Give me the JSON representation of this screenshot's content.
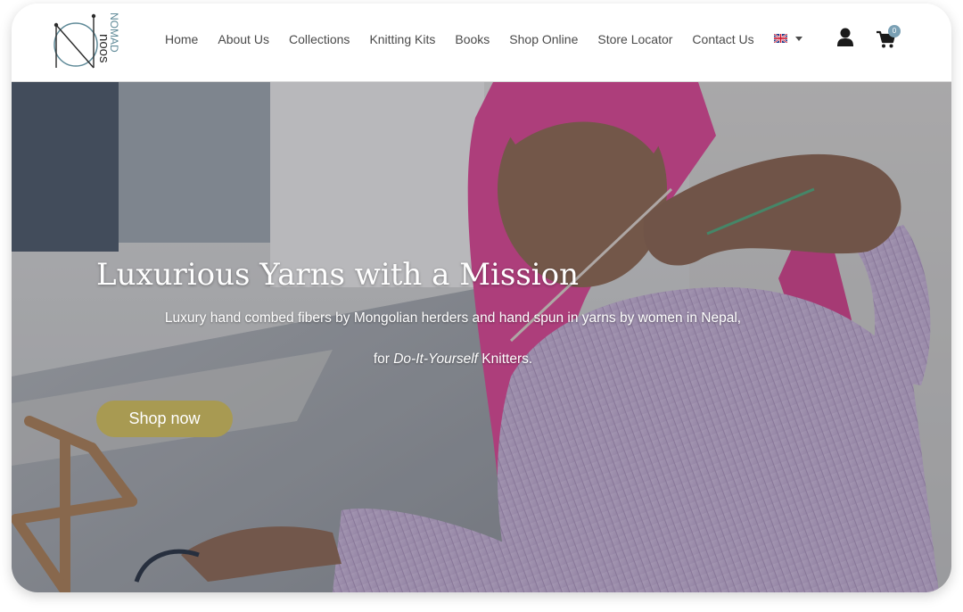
{
  "brand": {
    "logo_text_top": "NOMAD",
    "logo_text_bottom": "noos",
    "colors": {
      "accent": "#a89a52",
      "logo_teal": "#5f8a98",
      "text": "#4a4a4a",
      "badge": "#7aa0b4"
    }
  },
  "nav": {
    "items": [
      {
        "label": "Home"
      },
      {
        "label": "About Us"
      },
      {
        "label": "Collections"
      },
      {
        "label": "Knitting Kits"
      },
      {
        "label": "Books"
      },
      {
        "label": "Shop Online"
      },
      {
        "label": "Store Locator"
      },
      {
        "label": "Contact Us"
      }
    ],
    "language_icon": "uk-flag-icon",
    "account_icon": "user-icon",
    "cart_icon": "cart-icon",
    "cart_count": "0"
  },
  "hero": {
    "title": "Luxurious Yarns with a Mission",
    "line1": "Luxury hand combed fibers by Mongolian herders and hand spun in yarns by women in Nepal,",
    "line2_prefix": "for ",
    "line2_italic": "Do-It-Yourself",
    "line2_suffix": " Knitters.",
    "button_label": "Shop now"
  }
}
